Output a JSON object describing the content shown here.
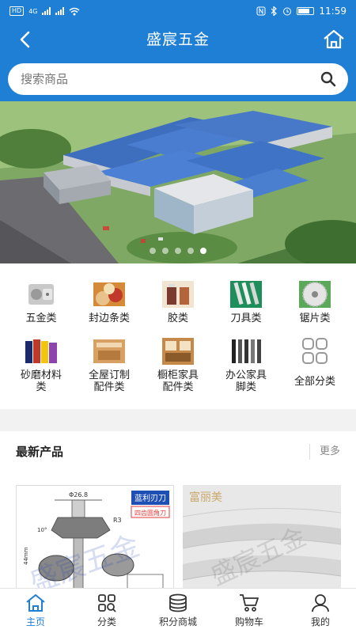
{
  "status_bar": {
    "network_badge": "HD",
    "network_type": "4G",
    "time": "11:59"
  },
  "header": {
    "title": "盛宸五金"
  },
  "search": {
    "placeholder": "搜索商品"
  },
  "categories": [
    {
      "label": "五金类",
      "icon": "hinge-icon"
    },
    {
      "label": "封边条类",
      "icon": "edge-banding-icon"
    },
    {
      "label": "胶类",
      "icon": "glue-icon"
    },
    {
      "label": "刀具类",
      "icon": "cutter-icon"
    },
    {
      "label": "锯片类",
      "icon": "saw-blade-icon"
    },
    {
      "label_line1": "砂磨材料",
      "label_line2": "类",
      "icon": "abrasive-icon"
    },
    {
      "label_line1": "全屋订制",
      "label_line2": "配件类",
      "icon": "custom-fitting-icon"
    },
    {
      "label_line1": "橱柜家具",
      "label_line2": "配件类",
      "icon": "cabinet-icon"
    },
    {
      "label_line1": "办公家具",
      "label_line2": "脚类",
      "icon": "office-leg-icon"
    },
    {
      "label": "全部分类",
      "icon": "grid-icon"
    }
  ],
  "section": {
    "title": "最新产品",
    "more": "更多"
  },
  "products": [
    {
      "brand_tag": "蓝利刃刀",
      "subtitle": "四齿圆角刀",
      "dimension_top": "Φ26.8",
      "dimension_r": "R3",
      "dimension_side": "44mm",
      "dimension_small": "10°",
      "watermark": "盛宸五金"
    },
    {
      "brand": "富丽美",
      "watermark": "盛宸五金"
    }
  ],
  "tabs": [
    {
      "label": "主页",
      "icon": "home-icon",
      "active": true
    },
    {
      "label": "分类",
      "icon": "category-icon"
    },
    {
      "label": "积分商城",
      "icon": "coins-icon"
    },
    {
      "label": "购物车",
      "icon": "cart-icon"
    },
    {
      "label": "我的",
      "icon": "user-icon"
    }
  ],
  "colors": {
    "brand": "#1e7fd4",
    "active_tab": "#1e7fd4"
  }
}
